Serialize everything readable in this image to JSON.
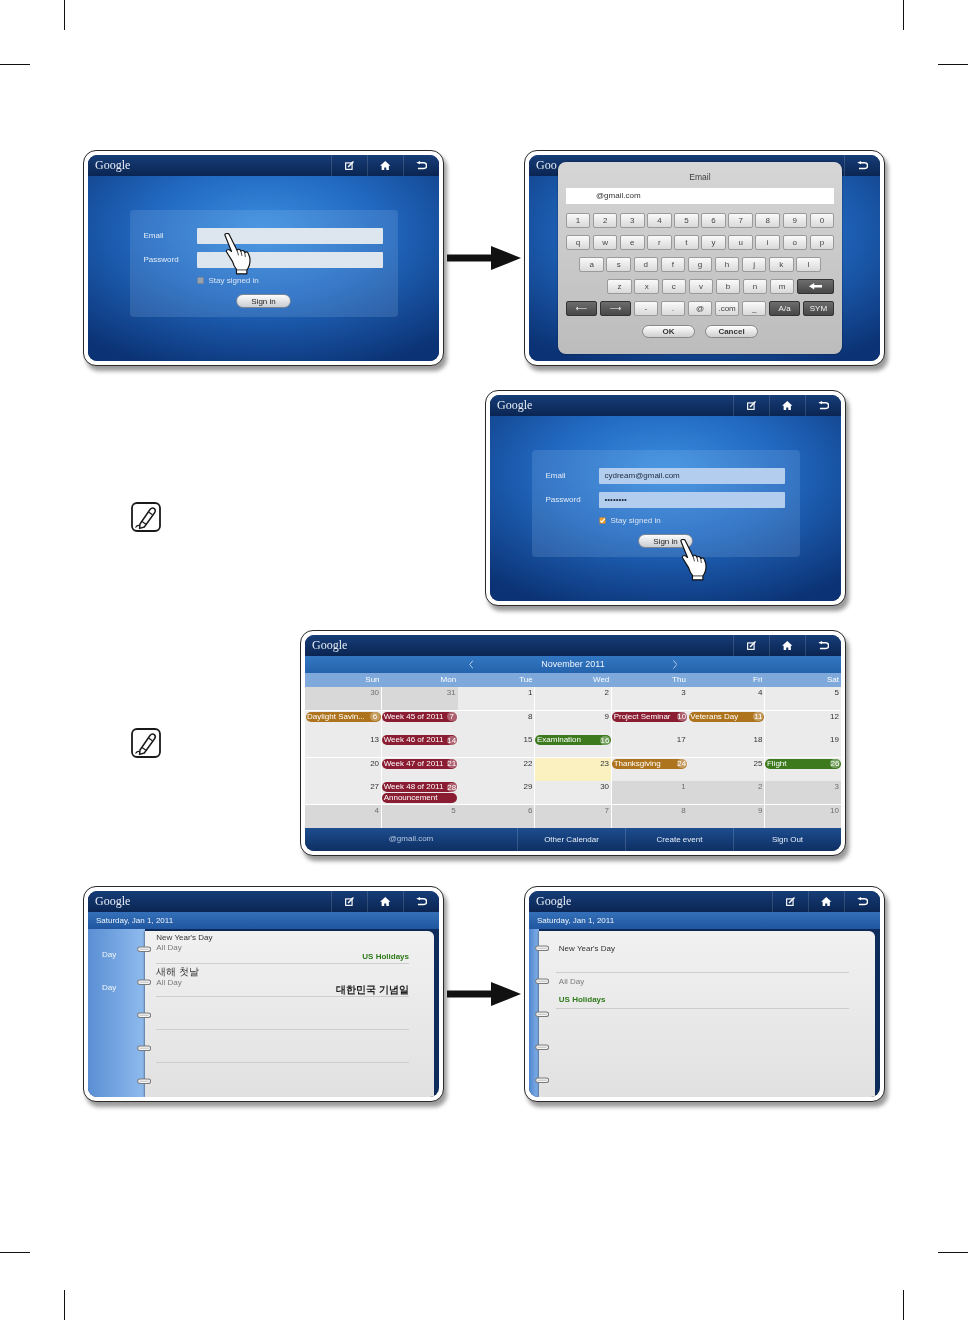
{
  "sections": [
    {
      "kind": "pair",
      "screens": [
        {
          "kind": "login",
          "header": {
            "logo": "Google",
            "buttons": [
              {
                "kind": "edit"
              },
              {
                "kind": "home"
              },
              {
                "kind": "back"
              }
            ]
          },
          "fields": [
            {
              "label": "Email",
              "touched": true
            },
            {
              "label": "Password",
              "touched": false
            }
          ],
          "remember": {
            "label": "Stay signed in",
            "checked": false
          },
          "submit": {
            "label": "Sign in",
            "touched": false
          }
        },
        {
          "kind": "keyboard",
          "header": {
            "logo": "Goo",
            "buttons": [
              {
                "kind": "back"
              }
            ]
          },
          "dialog": {
            "title": "Email",
            "value": "@gmail.com",
            "rows": [
              {
                "keys": [
                  {
                    "kind": "char",
                    "label": "1"
                  },
                  {
                    "kind": "char",
                    "label": "2"
                  },
                  {
                    "kind": "char",
                    "label": "3"
                  },
                  {
                    "kind": "char",
                    "label": "4"
                  },
                  {
                    "kind": "char",
                    "label": "5"
                  },
                  {
                    "kind": "char",
                    "label": "6"
                  },
                  {
                    "kind": "char",
                    "label": "7"
                  },
                  {
                    "kind": "char",
                    "label": "8"
                  },
                  {
                    "kind": "char",
                    "label": "9"
                  },
                  {
                    "kind": "char",
                    "label": "0"
                  }
                ]
              },
              {
                "keys": [
                  {
                    "kind": "char",
                    "label": "q"
                  },
                  {
                    "kind": "char",
                    "label": "w"
                  },
                  {
                    "kind": "char",
                    "label": "e"
                  },
                  {
                    "kind": "char",
                    "label": "r"
                  },
                  {
                    "kind": "char",
                    "label": "t"
                  },
                  {
                    "kind": "char",
                    "label": "y"
                  },
                  {
                    "kind": "char",
                    "label": "u"
                  },
                  {
                    "kind": "char",
                    "label": "i"
                  },
                  {
                    "kind": "char",
                    "label": "o"
                  },
                  {
                    "kind": "char",
                    "label": "p"
                  }
                ]
              },
              {
                "keys": [
                  {
                    "kind": "char",
                    "label": "a"
                  },
                  {
                    "kind": "char",
                    "label": "s"
                  },
                  {
                    "kind": "char",
                    "label": "d"
                  },
                  {
                    "kind": "char",
                    "label": "f"
                  },
                  {
                    "kind": "char",
                    "label": "g"
                  },
                  {
                    "kind": "char",
                    "label": "h"
                  },
                  {
                    "kind": "char",
                    "label": "j"
                  },
                  {
                    "kind": "char",
                    "label": "k"
                  },
                  {
                    "kind": "char",
                    "label": "l"
                  }
                ]
              },
              {
                "keys": [
                  {
                    "kind": "char",
                    "label": "z"
                  },
                  {
                    "kind": "char",
                    "label": "x"
                  },
                  {
                    "kind": "char",
                    "label": "c"
                  },
                  {
                    "kind": "char",
                    "label": "v"
                  },
                  {
                    "kind": "char",
                    "label": "b"
                  },
                  {
                    "kind": "char",
                    "label": "n"
                  },
                  {
                    "kind": "char",
                    "label": "m"
                  },
                  {
                    "kind": "backspace"
                  }
                ]
              },
              {
                "keys": [
                  {
                    "kind": "function",
                    "label": "⟵"
                  },
                  {
                    "kind": "function",
                    "label": "⟶"
                  },
                  {
                    "kind": "char",
                    "label": "-"
                  },
                  {
                    "kind": "char",
                    "label": "."
                  },
                  {
                    "kind": "char",
                    "label": "@"
                  },
                  {
                    "kind": "char",
                    "label": ".com"
                  },
                  {
                    "kind": "char",
                    "label": "_"
                  },
                  {
                    "kind": "function",
                    "label": "A/a"
                  },
                  {
                    "kind": "function",
                    "label": "SYM"
                  }
                ]
              }
            ],
            "buttons": [
              {
                "label": "OK"
              },
              {
                "label": "Cancel"
              }
            ]
          }
        }
      ]
    },
    {
      "kind": "noted",
      "screens": [
        {
          "kind": "login",
          "header": {
            "logo": "Google",
            "buttons": [
              {
                "kind": "edit"
              },
              {
                "kind": "home"
              },
              {
                "kind": "back"
              }
            ]
          },
          "fields": [
            {
              "label": "Email",
              "value": "cydream@gmail.com",
              "touched": false
            },
            {
              "label": "Password",
              "value": "••••••••",
              "touched": false
            }
          ],
          "remember": {
            "label": "Stay signed in",
            "checked": true
          },
          "submit": {
            "label": "Sign in",
            "touched": true
          }
        }
      ]
    },
    {
      "kind": "noted",
      "screens": [
        {
          "kind": "calendar",
          "header": {
            "logo": "Google",
            "buttons": [
              {
                "kind": "edit"
              },
              {
                "kind": "home"
              },
              {
                "kind": "back"
              }
            ]
          },
          "month": "November 2011",
          "weekdays": [
            "Sun",
            "Mon",
            "Tue",
            "Wed",
            "Thu",
            "Fri",
            "Sat"
          ],
          "weeks": [
            [
              {
                "day": "30",
                "outside": true,
                "selected": false
              },
              {
                "day": "31",
                "outside": true,
                "selected": false
              },
              {
                "day": "1",
                "outside": false,
                "selected": false
              },
              {
                "day": "2",
                "outside": false,
                "selected": false
              },
              {
                "day": "3",
                "outside": false,
                "selected": false
              },
              {
                "day": "4",
                "outside": false,
                "selected": false
              },
              {
                "day": "5",
                "outside": false,
                "selected": false
              }
            ],
            [
              {
                "day": "6",
                "outside": false,
                "selected": false,
                "events": [
                  {
                    "title": "Daylight Savin...",
                    "color": "#ad731d"
                  }
                ]
              },
              {
                "day": "7",
                "outside": false,
                "selected": false,
                "events": [
                  {
                    "title": "Week 45 of 2011",
                    "color": "#8a1d31"
                  }
                ]
              },
              {
                "day": "8",
                "outside": false,
                "selected": false
              },
              {
                "day": "9",
                "outside": false,
                "selected": false
              },
              {
                "day": "10",
                "outside": false,
                "selected": false,
                "events": [
                  {
                    "title": "Project Seminar",
                    "color": "#8a1d31"
                  }
                ]
              },
              {
                "day": "11",
                "outside": false,
                "selected": false,
                "events": [
                  {
                    "title": "Veterans Day",
                    "color": "#ad731d"
                  }
                ]
              },
              {
                "day": "12",
                "outside": false,
                "selected": false
              }
            ],
            [
              {
                "day": "13",
                "outside": false,
                "selected": false
              },
              {
                "day": "14",
                "outside": false,
                "selected": false,
                "events": [
                  {
                    "title": "Week 46 of 2011",
                    "color": "#8a1d31"
                  }
                ]
              },
              {
                "day": "15",
                "outside": false,
                "selected": false
              },
              {
                "day": "16",
                "outside": false,
                "selected": false,
                "events": [
                  {
                    "title": "Examination",
                    "color": "#3c7a1d"
                  }
                ]
              },
              {
                "day": "17",
                "outside": false,
                "selected": false
              },
              {
                "day": "18",
                "outside": false,
                "selected": false
              },
              {
                "day": "19",
                "outside": false,
                "selected": false
              }
            ],
            [
              {
                "day": "20",
                "outside": false,
                "selected": false
              },
              {
                "day": "21",
                "outside": false,
                "selected": false,
                "events": [
                  {
                    "title": "Week 47 of 2011",
                    "color": "#8a1d31"
                  }
                ]
              },
              {
                "day": "22",
                "outside": false,
                "selected": false
              },
              {
                "day": "23",
                "outside": false,
                "selected": true
              },
              {
                "day": "24",
                "outside": false,
                "selected": false,
                "events": [
                  {
                    "title": "Thanksgiving",
                    "color": "#ad731d"
                  }
                ]
              },
              {
                "day": "25",
                "outside": false,
                "selected": false
              },
              {
                "day": "26",
                "outside": false,
                "selected": false,
                "events": [
                  {
                    "title": "Flight",
                    "color": "#3c7a1d"
                  }
                ]
              }
            ],
            [
              {
                "day": "27",
                "outside": false,
                "selected": false
              },
              {
                "day": "28",
                "outside": false,
                "selected": false,
                "events": [
                  {
                    "title": "Week 48 of 2011",
                    "color": "#8a1d31"
                  },
                  {
                    "title": "Announcement",
                    "color": "#8a1d31"
                  }
                ]
              },
              {
                "day": "29",
                "outside": false,
                "selected": false
              },
              {
                "day": "30",
                "outside": false,
                "selected": false
              },
              {
                "day": "1",
                "outside": true,
                "selected": false
              },
              {
                "day": "2",
                "outside": true,
                "selected": false
              },
              {
                "day": "3",
                "outside": true,
                "selected": false
              }
            ],
            [
              {
                "day": "4",
                "outside": true,
                "selected": false
              },
              {
                "day": "5",
                "outside": true,
                "selected": false
              },
              {
                "day": "6",
                "outside": true,
                "selected": false
              },
              {
                "day": "7",
                "outside": true,
                "selected": false
              },
              {
                "day": "8",
                "outside": true,
                "selected": false
              },
              {
                "day": "9",
                "outside": true,
                "selected": false
              },
              {
                "day": "10",
                "outside": true,
                "selected": false
              }
            ]
          ],
          "footer": [
            {
              "kind": "account",
              "label": "@gmail.com"
            },
            {
              "kind": "link",
              "label": "Other Calendar"
            },
            {
              "kind": "link",
              "label": "Create event"
            },
            {
              "kind": "link",
              "label": "Sign Out"
            }
          ]
        }
      ]
    },
    {
      "kind": "pair",
      "screens": [
        {
          "kind": "day",
          "header": {
            "logo": "Google",
            "buttons": [
              {
                "kind": "edit"
              },
              {
                "kind": "home"
              },
              {
                "kind": "back"
              }
            ]
          },
          "date": "Saturday, Jan 1, 2011",
          "slot_labels": [
            "Day",
            "Day"
          ],
          "entries": [
            {
              "title": "New Year's Day",
              "time": "All Day",
              "calendar": "US Holidays",
              "color": "#2f7a1a"
            },
            {
              "title": "새해 첫날",
              "time": "All Day",
              "calendar": "대한민국 기념일",
              "color": "#222222"
            }
          ]
        },
        {
          "kind": "event",
          "header": {
            "logo": "Google",
            "buttons": [
              {
                "kind": "edit"
              },
              {
                "kind": "home"
              },
              {
                "kind": "back"
              }
            ]
          },
          "date": "Saturday, Jan 1, 2011",
          "title": "New Year's Day",
          "time": "All Day",
          "calendar": "US Holidays"
        }
      ]
    }
  ]
}
